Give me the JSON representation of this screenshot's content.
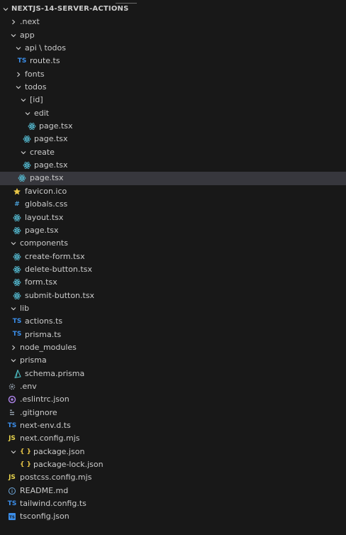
{
  "explorer": {
    "root": "NEXTJS-14-SERVER-ACTIONS",
    "items": [
      {
        "label": ".next",
        "type": "folder",
        "expanded": false
      },
      {
        "label": "app",
        "type": "folder",
        "expanded": true
      },
      {
        "label": "api \\ todos",
        "type": "folder",
        "expanded": true
      },
      {
        "label": "route.ts",
        "type": "file",
        "icon": "typescript-icon"
      },
      {
        "label": "fonts",
        "type": "folder",
        "expanded": false
      },
      {
        "label": "todos",
        "type": "folder",
        "expanded": true
      },
      {
        "label": "[id]",
        "type": "folder",
        "expanded": true
      },
      {
        "label": "edit",
        "type": "folder",
        "expanded": true
      },
      {
        "label": "page.tsx",
        "type": "file",
        "icon": "react-icon"
      },
      {
        "label": "page.tsx",
        "type": "file",
        "icon": "react-icon"
      },
      {
        "label": "create",
        "type": "folder",
        "expanded": true
      },
      {
        "label": "page.tsx",
        "type": "file",
        "icon": "react-icon"
      },
      {
        "label": "page.tsx",
        "type": "file",
        "icon": "react-icon",
        "selected": true
      },
      {
        "label": "favicon.ico",
        "type": "file",
        "icon": "star-icon"
      },
      {
        "label": "globals.css",
        "type": "file",
        "icon": "hash-icon"
      },
      {
        "label": "layout.tsx",
        "type": "file",
        "icon": "react-icon"
      },
      {
        "label": "page.tsx",
        "type": "file",
        "icon": "react-icon"
      },
      {
        "label": "components",
        "type": "folder",
        "expanded": true
      },
      {
        "label": "create-form.tsx",
        "type": "file",
        "icon": "react-icon"
      },
      {
        "label": "delete-button.tsx",
        "type": "file",
        "icon": "react-icon"
      },
      {
        "label": "form.tsx",
        "type": "file",
        "icon": "react-icon"
      },
      {
        "label": "submit-button.tsx",
        "type": "file",
        "icon": "react-icon"
      },
      {
        "label": "lib",
        "type": "folder",
        "expanded": true
      },
      {
        "label": "actions.ts",
        "type": "file",
        "icon": "typescript-icon"
      },
      {
        "label": "prisma.ts",
        "type": "file",
        "icon": "typescript-icon"
      },
      {
        "label": "node_modules",
        "type": "folder",
        "expanded": false
      },
      {
        "label": "prisma",
        "type": "folder",
        "expanded": true
      },
      {
        "label": "schema.prisma",
        "type": "file",
        "icon": "prisma-icon"
      },
      {
        "label": ".env",
        "type": "file",
        "icon": "gear-icon"
      },
      {
        "label": ".eslintrc.json",
        "type": "file",
        "icon": "eslint-icon"
      },
      {
        "label": ".gitignore",
        "type": "file",
        "icon": "git-icon"
      },
      {
        "label": "next-env.d.ts",
        "type": "file",
        "icon": "typescript-icon"
      },
      {
        "label": "next.config.mjs",
        "type": "file",
        "icon": "javascript-icon"
      },
      {
        "label": "package.json",
        "type": "file",
        "icon": "json-icon",
        "expanded": true
      },
      {
        "label": "package-lock.json",
        "type": "file",
        "icon": "json-icon"
      },
      {
        "label": "postcss.config.mjs",
        "type": "file",
        "icon": "javascript-icon"
      },
      {
        "label": "README.md",
        "type": "file",
        "icon": "info-icon"
      },
      {
        "label": "tailwind.config.ts",
        "type": "file",
        "icon": "typescript-icon"
      },
      {
        "label": "tsconfig.json",
        "type": "file",
        "icon": "tsconfig-icon"
      }
    ]
  },
  "icon_text": {
    "ts": "TS",
    "js": "JS",
    "braces": "{ }",
    "hash": "#"
  },
  "colors": {
    "background": "#181818",
    "text": "#cccccc",
    "selected": "#37373d",
    "ts_blue": "#3b8eea",
    "js_yellow": "#e8d44d",
    "react_blue": "#58c4dc",
    "star_yellow": "#e8c547"
  }
}
